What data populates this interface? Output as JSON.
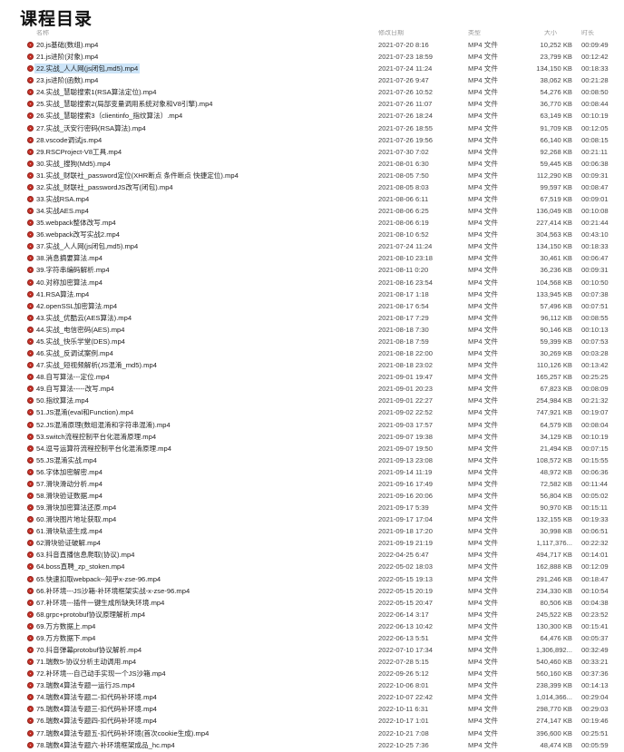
{
  "page_title": "课程目录",
  "header": {
    "name": "名称",
    "date": "修改日期",
    "type": "类型",
    "size": "大小",
    "duration": "时长"
  },
  "files": [
    {
      "name": "20.js基础(数组).mp4",
      "date": "2021-07-20 8:16",
      "type": "MP4 文件",
      "size": "10,252 KB",
      "dur": "00:09:49"
    },
    {
      "name": "21.js进阶(对象).mp4",
      "date": "2021-07-23 18:59",
      "type": "MP4 文件",
      "size": "23,799 KB",
      "dur": "00:12:42"
    },
    {
      "name": "22.实战_人人网(js闭包,md5).mp4",
      "date": "2021-07-24 11:24",
      "type": "MP4 文件",
      "size": "134,150 KB",
      "dur": "00:18:33",
      "selected": true
    },
    {
      "name": "23.js进阶(函数).mp4",
      "date": "2021-07-26 9:47",
      "type": "MP4 文件",
      "size": "38,062 KB",
      "dur": "00:21:28"
    },
    {
      "name": "24.实战_慧聪搜索1(RSA算法定位).mp4",
      "date": "2021-07-26 10:52",
      "type": "MP4 文件",
      "size": "54,276 KB",
      "dur": "00:08:50"
    },
    {
      "name": "25.实战_慧聪搜索2(局部变量调用系统对象和V8引擎).mp4",
      "date": "2021-07-26 11:07",
      "type": "MP4 文件",
      "size": "36,770 KB",
      "dur": "00:08:44"
    },
    {
      "name": "26.实战_慧聪搜索3（clientinfo_指纹算法）.mp4",
      "date": "2021-07-26 18:24",
      "type": "MP4 文件",
      "size": "63,149 KB",
      "dur": "00:10:19"
    },
    {
      "name": "27.实战_沃安行密码(RSA算法).mp4",
      "date": "2021-07-26 18:55",
      "type": "MP4 文件",
      "size": "91,709 KB",
      "dur": "00:12:05"
    },
    {
      "name": "28.vscode调试js.mp4",
      "date": "2021-07-26 19:56",
      "type": "MP4 文件",
      "size": "66,140 KB",
      "dur": "00:08:15"
    },
    {
      "name": "29.RSCProject-V8工具.mp4",
      "date": "2021-07-30 7:02",
      "type": "MP4 文件",
      "size": "92,268 KB",
      "dur": "00:21:11"
    },
    {
      "name": "30.实战_搜狗(Md5).mp4",
      "date": "2021-08-01 6:30",
      "type": "MP4 文件",
      "size": "59,445 KB",
      "dur": "00:06:38"
    },
    {
      "name": "31.实战_财联社_password定位(XHR断点 条件断点 快捷定位).mp4",
      "date": "2021-08-05 7:50",
      "type": "MP4 文件",
      "size": "112,290 KB",
      "dur": "00:09:31"
    },
    {
      "name": "32.实战_财联社_passwordJS改写(闭包).mp4",
      "date": "2021-08-05 8:03",
      "type": "MP4 文件",
      "size": "99,597 KB",
      "dur": "00:08:47"
    },
    {
      "name": "33.实战RSA.mp4",
      "date": "2021-08-06 6:11",
      "type": "MP4 文件",
      "size": "67,519 KB",
      "dur": "00:09:01"
    },
    {
      "name": "34.实战AES.mp4",
      "date": "2021-08-06 6:25",
      "type": "MP4 文件",
      "size": "136,049 KB",
      "dur": "00:10:08"
    },
    {
      "name": "35.webpack整体改写.mp4",
      "date": "2021-08-06 6:19",
      "type": "MP4 文件",
      "size": "227,414 KB",
      "dur": "00:21:44"
    },
    {
      "name": "36.webpack改写实战2.mp4",
      "date": "2021-08-10 6:52",
      "type": "MP4 文件",
      "size": "304,563 KB",
      "dur": "00:43:10"
    },
    {
      "name": "37.实战_人人网(js闭包,md5).mp4",
      "date": "2021-07-24 11:24",
      "type": "MP4 文件",
      "size": "134,150 KB",
      "dur": "00:18:33"
    },
    {
      "name": "38.消息摘要算法.mp4",
      "date": "2021-08-10 23:18",
      "type": "MP4 文件",
      "size": "30,461 KB",
      "dur": "00:06:47"
    },
    {
      "name": "39.字符串编码解析.mp4",
      "date": "2021-08-11 0:20",
      "type": "MP4 文件",
      "size": "36,236 KB",
      "dur": "00:09:31"
    },
    {
      "name": "40.对称加密算法.mp4",
      "date": "2021-08-16 23:54",
      "type": "MP4 文件",
      "size": "104,568 KB",
      "dur": "00:10:50"
    },
    {
      "name": "41.RSA算法.mp4",
      "date": "2021-08-17 1:18",
      "type": "MP4 文件",
      "size": "133,945 KB",
      "dur": "00:07:38"
    },
    {
      "name": "42.openSSL加密算法.mp4",
      "date": "2021-08-17 6:54",
      "type": "MP4 文件",
      "size": "57,496 KB",
      "dur": "00:07:51"
    },
    {
      "name": "43.实战_优酷云(AES算法).mp4",
      "date": "2021-08-17 7:29",
      "type": "MP4 文件",
      "size": "96,112 KB",
      "dur": "00:08:55"
    },
    {
      "name": "44.实战_电信密码(AES).mp4",
      "date": "2021-08-18 7:30",
      "type": "MP4 文件",
      "size": "90,146 KB",
      "dur": "00:10:13"
    },
    {
      "name": "45.实战_快乐学堂(DES).mp4",
      "date": "2021-08-18 7:59",
      "type": "MP4 文件",
      "size": "59,399 KB",
      "dur": "00:07:53"
    },
    {
      "name": "46.实战_反调试案例.mp4",
      "date": "2021-08-18 22:00",
      "type": "MP4 文件",
      "size": "30,269 KB",
      "dur": "00:03:28"
    },
    {
      "name": "47.实战_短视频解析(JS混淆_md5).mp4",
      "date": "2021-08-18 23:02",
      "type": "MP4 文件",
      "size": "110,126 KB",
      "dur": "00:13:42"
    },
    {
      "name": "48.自写算法---定位.mp4",
      "date": "2021-09-01 19:47",
      "type": "MP4 文件",
      "size": "165,257 KB",
      "dur": "00:25:25"
    },
    {
      "name": "49.自写算法-----改写.mp4",
      "date": "2021-09-01 20:23",
      "type": "MP4 文件",
      "size": "67,823 KB",
      "dur": "00:08:09"
    },
    {
      "name": "50.指纹算法.mp4",
      "date": "2021-09-01 22:27",
      "type": "MP4 文件",
      "size": "254,984 KB",
      "dur": "00:21:32"
    },
    {
      "name": "51.JS混淆(eval和Function).mp4",
      "date": "2021-09-02 22:52",
      "type": "MP4 文件",
      "size": "747,921 KB",
      "dur": "00:19:07"
    },
    {
      "name": "52.JS混淆原理(数组混淆和字符串混淆).mp4",
      "date": "2021-09-03 17:57",
      "type": "MP4 文件",
      "size": "64,579 KB",
      "dur": "00:08:04"
    },
    {
      "name": "53.switch流程控制平台化混淆原理.mp4",
      "date": "2021-09-07 19:38",
      "type": "MP4 文件",
      "size": "34,129 KB",
      "dur": "00:10:19"
    },
    {
      "name": "54.逗号运算符流程控制平台化混淆原理.mp4",
      "date": "2021-09-07 19:50",
      "type": "MP4 文件",
      "size": "21,494 KB",
      "dur": "00:07:15"
    },
    {
      "name": "55.JS混淆实战.mp4",
      "date": "2021-09-13 23:08",
      "type": "MP4 文件",
      "size": "108,572 KB",
      "dur": "00:15:55"
    },
    {
      "name": "56.字体加密解密.mp4",
      "date": "2021-09-14 11:19",
      "type": "MP4 文件",
      "size": "48,972 KB",
      "dur": "00:06:36"
    },
    {
      "name": "57.滑块滑动分析.mp4",
      "date": "2021-09-16 17:49",
      "type": "MP4 文件",
      "size": "72,582 KB",
      "dur": "00:11:44"
    },
    {
      "name": "58.滑块验证数据.mp4",
      "date": "2021-09-16 20:06",
      "type": "MP4 文件",
      "size": "56,804 KB",
      "dur": "00:05:02"
    },
    {
      "name": "59.滑块加密算法还原.mp4",
      "date": "2021-09-17 5:39",
      "type": "MP4 文件",
      "size": "90,970 KB",
      "dur": "00:15:11"
    },
    {
      "name": "60.滑块图片地址获取.mp4",
      "date": "2021-09-17 17:04",
      "type": "MP4 文件",
      "size": "132,155 KB",
      "dur": "00:19:33"
    },
    {
      "name": "61.滑块轨迹生成.mp4",
      "date": "2021-09-18 17:20",
      "type": "MP4 文件",
      "size": "30,998 KB",
      "dur": "00:06:51"
    },
    {
      "name": "62滑块验证破解.mp4",
      "date": "2021-09-19 21:19",
      "type": "MP4 文件",
      "size": "1,117,376...",
      "dur": "00:22:32"
    },
    {
      "name": "63.抖音直播信息爬取(协议).mp4",
      "date": "2022-04-25 6:47",
      "type": "MP4 文件",
      "size": "494,717 KB",
      "dur": "00:14:01"
    },
    {
      "name": "64.boss直聘_zp_stoken.mp4",
      "date": "2022-05-02 18:03",
      "type": "MP4 文件",
      "size": "162,888 KB",
      "dur": "00:12:09"
    },
    {
      "name": "65.快速扣取webpack--知乎x-zse-96.mp4",
      "date": "2022-05-15 19:13",
      "type": "MP4 文件",
      "size": "291,246 KB",
      "dur": "00:18:47"
    },
    {
      "name": "66.补环境---JS沙箱-补环境框架实战-x-zse-96.mp4",
      "date": "2022-05-15 20:19",
      "type": "MP4 文件",
      "size": "234,330 KB",
      "dur": "00:10:54"
    },
    {
      "name": "67.补环境---插件一键生成所缺失环境.mp4",
      "date": "2022-05-15 20:47",
      "type": "MP4 文件",
      "size": "80,506 KB",
      "dur": "00:04:38"
    },
    {
      "name": "68.grpc+protobuf协议原理解析.mp4",
      "date": "2022-06-14 3:17",
      "type": "MP4 文件",
      "size": "245,522 KB",
      "dur": "00:23:52"
    },
    {
      "name": "69.万方数据上.mp4",
      "date": "2022-06-13 10:42",
      "type": "MP4 文件",
      "size": "130,300 KB",
      "dur": "00:15:41"
    },
    {
      "name": "69.万方数据下.mp4",
      "date": "2022-06-13 5:51",
      "type": "MP4 文件",
      "size": "64,476 KB",
      "dur": "00:05:37"
    },
    {
      "name": "70.抖音弹幕protobuf协议解析.mp4",
      "date": "2022-07-10 17:34",
      "type": "MP4 文件",
      "size": "1,306,892...",
      "dur": "00:32:49"
    },
    {
      "name": "71.瑞数5-协议分析主动调用.mp4",
      "date": "2022-07-28 5:15",
      "type": "MP4 文件",
      "size": "540,460 KB",
      "dur": "00:33:21"
    },
    {
      "name": "72.补环境---自己动手实现一个JS沙箱.mp4",
      "date": "2022-09-26 5:12",
      "type": "MP4 文件",
      "size": "560,160 KB",
      "dur": "00:37:36"
    },
    {
      "name": "73.瑞数4算法专题一运行JS.mp4",
      "date": "2022-10-06 8:01",
      "type": "MP4 文件",
      "size": "238,399 KB",
      "dur": "00:14:13"
    },
    {
      "name": "74.瑞数4算法专题二-扣代码补环境.mp4",
      "date": "2022-10-07 22:42",
      "type": "MP4 文件",
      "size": "1,014,366...",
      "dur": "00:29:04"
    },
    {
      "name": "75.瑞数4算法专题三-扣代码补环境.mp4",
      "date": "2022-10-11 6:31",
      "type": "MP4 文件",
      "size": "298,770 KB",
      "dur": "00:29:03"
    },
    {
      "name": "76.瑞数4算法专题四-扣代码补环境.mp4",
      "date": "2022-10-17 1:01",
      "type": "MP4 文件",
      "size": "274,147 KB",
      "dur": "00:19:46"
    },
    {
      "name": "77.瑞数4算法专题五-扣代码补环境(首次cookie生成).mp4",
      "date": "2022-10-21 7:08",
      "type": "MP4 文件",
      "size": "396,600 KB",
      "dur": "00:25:51"
    },
    {
      "name": "78.瑞数4算法专题六-补环境框架成品_hc.mp4",
      "date": "2022-10-25 7:36",
      "type": "MP4 文件",
      "size": "48,474 KB",
      "dur": "00:05:59"
    }
  ]
}
